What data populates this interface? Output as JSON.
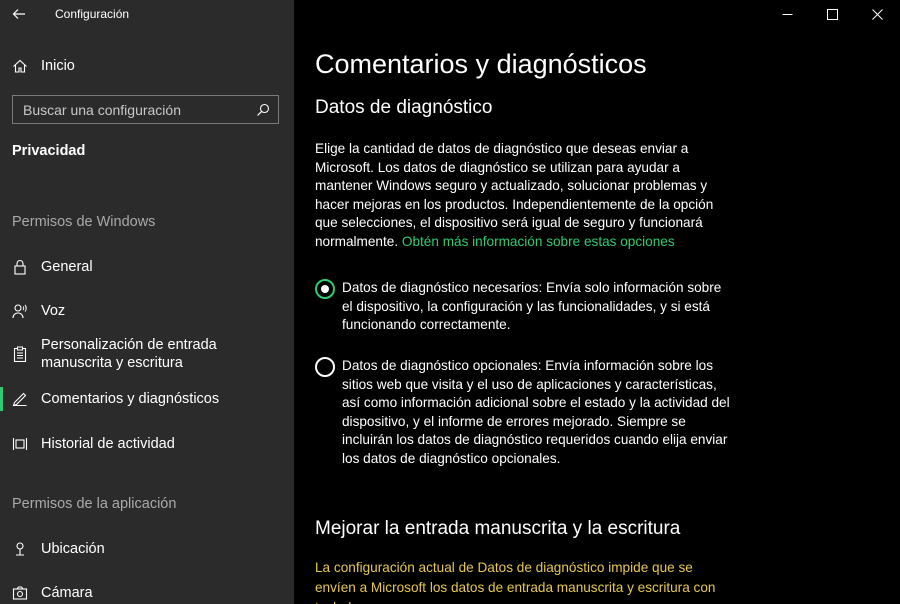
{
  "window": {
    "title": "Configuración",
    "controls": [
      "minimize-icon",
      "maximize-icon",
      "close-icon"
    ]
  },
  "sidebar": {
    "home_label": "Inicio",
    "search_placeholder": "Buscar una configuración",
    "current_section": "Privacidad",
    "group_windows": "Permisos de Windows",
    "group_app": "Permisos de la aplicación",
    "items": [
      {
        "label": "General",
        "icon": "lock-icon"
      },
      {
        "label": "Voz",
        "icon": "voice-icon"
      },
      {
        "label": "Personalización de entrada manuscrita y escritura",
        "icon": "clipboard-icon"
      },
      {
        "label": "Comentarios y diagnósticos",
        "icon": "feedback-icon",
        "active": true
      },
      {
        "label": "Historial de actividad",
        "icon": "timeline-icon"
      },
      {
        "label": "Ubicación",
        "icon": "location-icon"
      },
      {
        "label": "Cámara",
        "icon": "camera-icon"
      }
    ]
  },
  "main": {
    "title": "Comentarios y diagnósticos",
    "section1_heading": "Datos de diagnóstico",
    "section1_body": "Elige la cantidad de datos de diagnóstico que deseas enviar a Microsoft. Los datos de diagnóstico se utilizan para ayudar a mantener Windows seguro y actualizado, solucionar problemas y hacer mejoras en los productos. Independientemente de la opción que selecciones, el dispositivo será igual de seguro y funcionará normalmente.",
    "section1_link": "Obtén más información sobre estas opciones",
    "options": [
      {
        "label": "Datos de diagnóstico necesarios: Envía solo información sobre el dispositivo, la configuración y las funcionalidades, y si está funcionando correctamente.",
        "checked": true
      },
      {
        "label": "Datos de diagnóstico opcionales: Envía información sobre los sitios web que visita y el uso de aplicaciones y características, así como información adicional sobre el estado y la actividad del dispositivo, y el informe de errores mejorado. Siempre se incluirán los datos de diagnóstico requeridos cuando elija enviar los datos de diagnóstico opcionales.",
        "checked": false
      }
    ],
    "section2_heading": "Mejorar la entrada manuscrita y la escritura",
    "section2_warning": "La configuración actual de Datos de diagnóstico impide que se envíen a Microsoft los datos de entrada manuscrita y escritura con teclado."
  },
  "colors": {
    "accent": "#2ecc71",
    "warning": "#e6c84a",
    "sidebar_bg": "#2b2b2b",
    "main_bg": "#000000"
  }
}
